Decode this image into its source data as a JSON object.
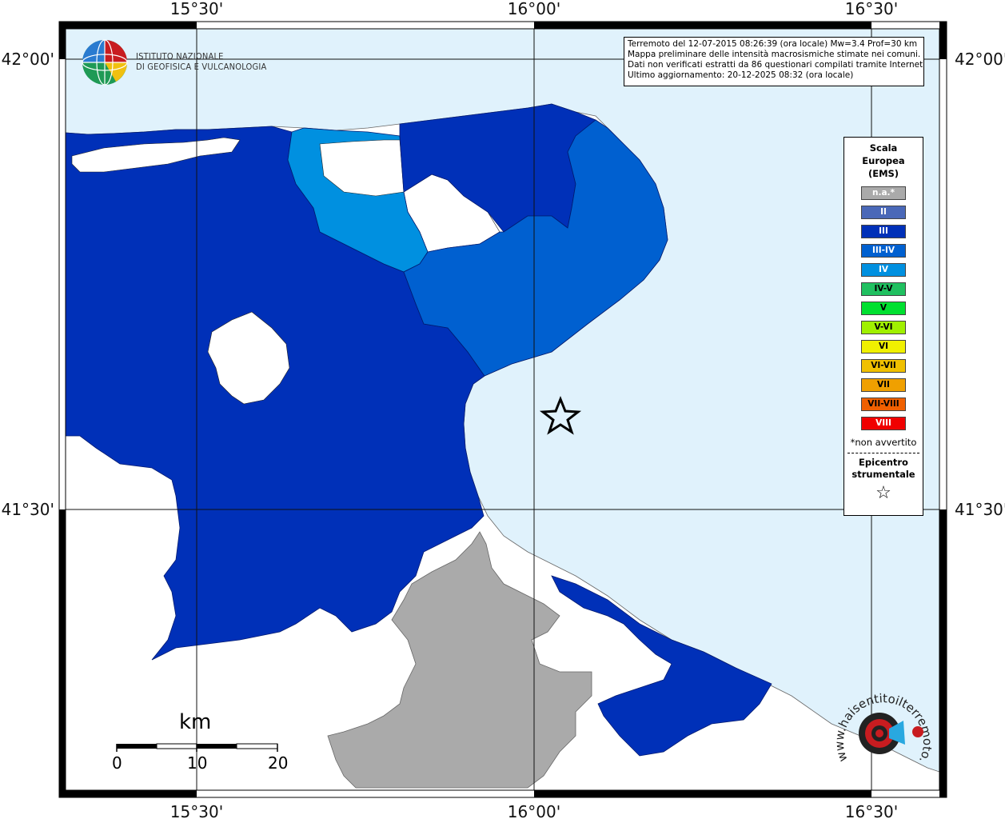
{
  "header": {
    "institute_line1": "ISTITUTO NAZIONALE",
    "institute_line2": "DI GEOFISICA E VULCANOLOGIA"
  },
  "info": {
    "line1": "Terremoto del 12-07-2015 08:26:39 (ora locale) Mw=3.4 Prof=30 km",
    "line2": "Mappa preliminare delle intensità macrosismiche stimate nei comuni.",
    "line3": "Dati non verificati estratti da 86 questionari compilati tramite Internet.",
    "line4": "Ultimo aggiornamento: 20-12-2025 08:32 (ora locale)"
  },
  "axes": {
    "top": [
      "15°30'",
      "16°00'",
      "16°30'"
    ],
    "bottom": [
      "15°30'",
      "16°00'",
      "16°30'"
    ],
    "left": [
      "42°00'",
      "41°30'"
    ],
    "right": [
      "42°00'",
      "41°30'"
    ]
  },
  "legend": {
    "title_line1": "Scala",
    "title_line2": "Europea",
    "title_line3": "(EMS)",
    "items": [
      {
        "label": "n.a.*",
        "color": "#aaaaaa",
        "text_color": "#ffffff"
      },
      {
        "label": "II",
        "color": "#4a68b8",
        "text_color": "#ffffff"
      },
      {
        "label": "III",
        "color": "#0030b8",
        "text_color": "#ffffff"
      },
      {
        "label": "III-IV",
        "color": "#0060d0",
        "text_color": "#ffffff"
      },
      {
        "label": "IV",
        "color": "#0090e0",
        "text_color": "#ffffff"
      },
      {
        "label": "IV-V",
        "color": "#20c060",
        "text_color": "#000000"
      },
      {
        "label": "V",
        "color": "#00e030",
        "text_color": "#000000"
      },
      {
        "label": "V-VI",
        "color": "#a0f000",
        "text_color": "#000000"
      },
      {
        "label": "VI",
        "color": "#f0f000",
        "text_color": "#000000"
      },
      {
        "label": "VI-VII",
        "color": "#f0c000",
        "text_color": "#000000"
      },
      {
        "label": "VII",
        "color": "#f0a000",
        "text_color": "#000000"
      },
      {
        "label": "VII-VIII",
        "color": "#f06000",
        "text_color": "#000000"
      },
      {
        "label": "VIII",
        "color": "#f00000",
        "text_color": "#ffffff"
      }
    ],
    "note": "*non avvertito",
    "epi_line1": "Epicentro",
    "epi_line2": "strumentale",
    "epi_symbol": "☆"
  },
  "scale_bar": {
    "unit": "km",
    "ticks": [
      "0",
      "10",
      "20"
    ]
  },
  "badge": {
    "site": "www.haisentitoilterremoto.it"
  },
  "colors": {
    "sea": "#e0f2fc",
    "III": "#0030b8",
    "III_IV": "#0060d0",
    "IV": "#0090e0",
    "na": "#aaaaaa"
  }
}
